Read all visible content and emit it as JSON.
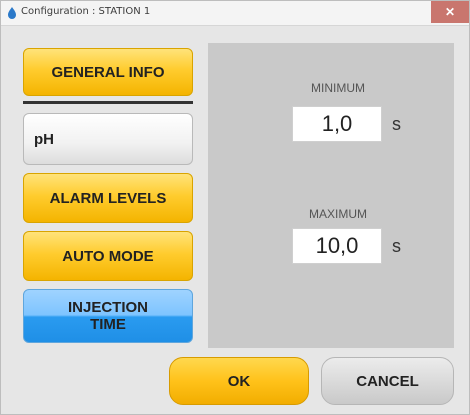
{
  "window": {
    "title": "Configuration : STATION 1",
    "close_glyph": "✕"
  },
  "nav": {
    "general_info": "GENERAL INFO",
    "ph": "pH",
    "alarm_levels": "ALARM LEVELS",
    "auto_mode": "AUTO MODE",
    "injection_time": "INJECTION\nTIME"
  },
  "panel": {
    "minimum": {
      "label": "MINIMUM",
      "value": "1,0",
      "unit": "s"
    },
    "maximum": {
      "label": "MAXIMUM",
      "value": "10,0",
      "unit": "s"
    }
  },
  "actions": {
    "ok": "OK",
    "cancel": "CANCEL"
  },
  "colors": {
    "accent_yellow": "#ffcc2e",
    "accent_blue": "#2a9bf0",
    "panel_gray": "#c9c9c9"
  }
}
